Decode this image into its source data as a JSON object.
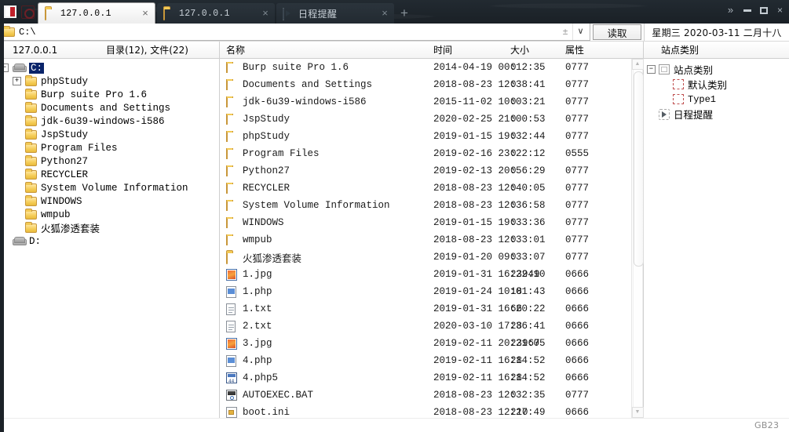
{
  "window": {
    "app_icon": "caidao-app-icon",
    "secondary_icon": "target-icon",
    "controls": {
      "overflow": "»",
      "minimize": "minimize-icon",
      "maximize": "maximize-icon",
      "close": "×"
    }
  },
  "tabs": {
    "items": [
      {
        "label": "127.0.0.1",
        "icon": "folder-icon",
        "active": true,
        "cjk": false,
        "close": "×"
      },
      {
        "label": "127.0.0.1",
        "icon": "folder-icon",
        "active": false,
        "cjk": false,
        "close": "×"
      },
      {
        "label": "日程提醒",
        "icon": "clock-icon",
        "active": false,
        "cjk": true,
        "close": "×"
      }
    ],
    "add_label": "+"
  },
  "address": {
    "icon": "folder-icon",
    "value": "C:\\",
    "placeholder": "",
    "pin_label": "±",
    "dropdown_label": "∨",
    "read_button": "读取"
  },
  "datebox": {
    "text": "星期三 2020-03-11 二月十八"
  },
  "left_pane": {
    "header_host": "127.0.0.1",
    "header_count": "目录(12), 文件(22)",
    "tree": [
      {
        "depth": 0,
        "expander": "−",
        "icon": "drive-icon",
        "label": "C:",
        "selected": true,
        "cjk": false
      },
      {
        "depth": 1,
        "expander": "+",
        "icon": "folder-icon",
        "label": "phpStudy",
        "selected": false,
        "cjk": false
      },
      {
        "depth": 1,
        "expander": "",
        "icon": "folder-icon",
        "label": "Burp suite Pro 1.6",
        "selected": false,
        "cjk": false
      },
      {
        "depth": 1,
        "expander": "",
        "icon": "folder-icon",
        "label": "Documents and Settings",
        "selected": false,
        "cjk": false
      },
      {
        "depth": 1,
        "expander": "",
        "icon": "folder-icon",
        "label": "jdk-6u39-windows-i586",
        "selected": false,
        "cjk": false
      },
      {
        "depth": 1,
        "expander": "",
        "icon": "folder-icon",
        "label": "JspStudy",
        "selected": false,
        "cjk": false
      },
      {
        "depth": 1,
        "expander": "",
        "icon": "folder-icon",
        "label": "Program Files",
        "selected": false,
        "cjk": false
      },
      {
        "depth": 1,
        "expander": "",
        "icon": "folder-icon",
        "label": "Python27",
        "selected": false,
        "cjk": false
      },
      {
        "depth": 1,
        "expander": "",
        "icon": "folder-icon",
        "label": "RECYCLER",
        "selected": false,
        "cjk": false
      },
      {
        "depth": 1,
        "expander": "",
        "icon": "folder-icon",
        "label": "System Volume Information",
        "selected": false,
        "cjk": false
      },
      {
        "depth": 1,
        "expander": "",
        "icon": "folder-icon",
        "label": "WINDOWS",
        "selected": false,
        "cjk": false
      },
      {
        "depth": 1,
        "expander": "",
        "icon": "folder-icon",
        "label": "wmpub",
        "selected": false,
        "cjk": false
      },
      {
        "depth": 1,
        "expander": "",
        "icon": "folder-icon",
        "label": "火狐渗透套装",
        "selected": false,
        "cjk": true
      },
      {
        "depth": 0,
        "expander": "",
        "icon": "drive-icon",
        "label": "D:",
        "selected": false,
        "cjk": false
      }
    ]
  },
  "file_list": {
    "columns": [
      "名称",
      "时间",
      "大小",
      "属性"
    ],
    "rows": [
      {
        "icon": "folder-icon",
        "name": "Burp suite Pro 1.6",
        "cjk": false,
        "time": "2014-04-19 00:12:35",
        "size": "0",
        "attr": "0777"
      },
      {
        "icon": "folder-icon",
        "name": "Documents and Settings",
        "cjk": false,
        "time": "2018-08-23 12:38:41",
        "size": "0",
        "attr": "0777"
      },
      {
        "icon": "folder-icon",
        "name": "jdk-6u39-windows-i586",
        "cjk": false,
        "time": "2015-11-02 10:03:21",
        "size": "0",
        "attr": "0777"
      },
      {
        "icon": "folder-icon",
        "name": "JspStudy",
        "cjk": false,
        "time": "2020-02-25 21:00:53",
        "size": "0",
        "attr": "0777"
      },
      {
        "icon": "folder-icon",
        "name": "phpStudy",
        "cjk": false,
        "time": "2019-01-15 19:32:44",
        "size": "0",
        "attr": "0777"
      },
      {
        "icon": "folder-icon",
        "name": "Program Files",
        "cjk": false,
        "time": "2019-02-16 23:22:12",
        "size": "0",
        "attr": "0555"
      },
      {
        "icon": "folder-icon",
        "name": "Python27",
        "cjk": false,
        "time": "2019-02-13 20:56:29",
        "size": "0",
        "attr": "0777"
      },
      {
        "icon": "folder-icon",
        "name": "RECYCLER",
        "cjk": false,
        "time": "2018-08-23 12:40:05",
        "size": "0",
        "attr": "0777"
      },
      {
        "icon": "folder-icon",
        "name": "System Volume Information",
        "cjk": false,
        "time": "2018-08-23 12:36:58",
        "size": "0",
        "attr": "0777"
      },
      {
        "icon": "folder-icon",
        "name": "WINDOWS",
        "cjk": false,
        "time": "2019-01-15 19:33:36",
        "size": "0",
        "attr": "0777"
      },
      {
        "icon": "folder-icon",
        "name": "wmpub",
        "cjk": false,
        "time": "2018-08-23 12:33:01",
        "size": "0",
        "attr": "0777"
      },
      {
        "icon": "folder-icon",
        "name": "火狐渗透套装",
        "cjk": true,
        "time": "2019-01-20 09:33:07",
        "size": "0",
        "attr": "0777"
      },
      {
        "icon": "jpg-file-icon",
        "name": "1.jpg",
        "cjk": false,
        "time": "2019-01-31 16:22:10",
        "size": "23949",
        "attr": "0666"
      },
      {
        "icon": "php-file-icon",
        "name": "1.php",
        "cjk": false,
        "time": "2019-01-24 10:01:43",
        "size": "18",
        "attr": "0666"
      },
      {
        "icon": "txt-file-icon",
        "name": "1.txt",
        "cjk": false,
        "time": "2019-01-31 16:20:22",
        "size": "66",
        "attr": "0666"
      },
      {
        "icon": "txt-file-icon",
        "name": "2.txt",
        "cjk": false,
        "time": "2020-03-10 17:36:41",
        "size": "28",
        "attr": "0666"
      },
      {
        "icon": "jpg-file-icon",
        "name": "3.jpg",
        "cjk": false,
        "time": "2019-02-11 20:21:05",
        "size": "23967",
        "attr": "0666"
      },
      {
        "icon": "php-file-icon",
        "name": "4.php",
        "cjk": false,
        "time": "2019-02-11 16:14:52",
        "size": "28",
        "attr": "0666"
      },
      {
        "icon": "php5-file-icon",
        "name": "4.php5",
        "cjk": false,
        "time": "2019-02-11 16:14:52",
        "size": "28",
        "attr": "0666"
      },
      {
        "icon": "bat-file-icon",
        "name": "AUTOEXEC.BAT",
        "cjk": false,
        "time": "2018-08-23 12:32:35",
        "size": "0",
        "attr": "0777"
      },
      {
        "icon": "ini-file-icon",
        "name": "boot.ini",
        "cjk": false,
        "time": "2018-08-23 12:27:49",
        "size": "210",
        "attr": "0666"
      }
    ],
    "scrollbar": {
      "up": "▲",
      "down": "▼"
    }
  },
  "right_pane": {
    "header": "站点类别",
    "tree": [
      {
        "depth": 0,
        "expander": "−",
        "icon": "category-icon",
        "label": "站点类别",
        "mono": false
      },
      {
        "depth": 1,
        "expander": "",
        "icon": "type-icon",
        "label": "默认类别",
        "mono": false
      },
      {
        "depth": 1,
        "expander": "",
        "icon": "type-icon",
        "label": "Type1",
        "mono": true
      },
      {
        "depth": 0,
        "expander": "",
        "icon": "schedule-icon",
        "label": "日程提醒",
        "mono": false
      }
    ]
  },
  "statusbar": {
    "encoding": "GB23"
  }
}
